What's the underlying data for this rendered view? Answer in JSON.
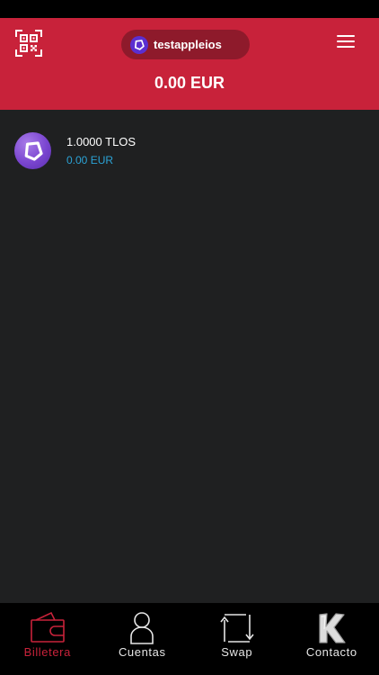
{
  "header": {
    "account_name": "testappleios",
    "total_balance": "0.00 EUR",
    "background_color": "#c8223a",
    "pill_color": "#8e1a2b"
  },
  "tokens": [
    {
      "amount": "1.0000 TLOS",
      "fiat_value": "0.00 EUR",
      "icon": "telos-logo-icon"
    }
  ],
  "bottom_nav": {
    "active_color": "#c8223a",
    "items": [
      {
        "label": "Billetera",
        "icon": "wallet-icon",
        "active": true
      },
      {
        "label": "Cuentas",
        "icon": "user-icon",
        "active": false
      },
      {
        "label": "Swap",
        "icon": "swap-icon",
        "active": false
      },
      {
        "label": "Contacto",
        "icon": "k-logo-icon",
        "active": false
      }
    ]
  }
}
